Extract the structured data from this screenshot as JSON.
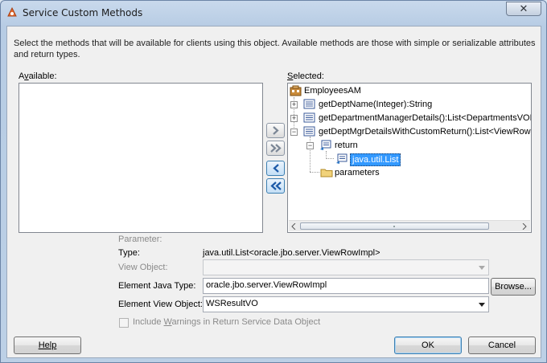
{
  "window": {
    "title": "Service Custom Methods",
    "close_symbol": "✕"
  },
  "description": "Select the methods that will be available for clients using this object.  Available methods are those with simple or serializable attributes and return types.",
  "available": {
    "label_pre": "A",
    "label_mnemonic": "v",
    "label_post": "ailable:"
  },
  "selected": {
    "label_mnemonic": "S",
    "label_post": "elected:",
    "tree": {
      "root": "EmployeesAM",
      "methods": [
        "getDeptName(Integer):String",
        "getDepartmentManagerDetails():List<DepartmentsVOR",
        "getDeptMgrDetailsWithCustomReturn():List<ViewRowI"
      ],
      "return_node": "return",
      "return_type": "java.util.List",
      "parameters_node": "parameters"
    }
  },
  "move_buttons": {
    "add_one": "add-selected-icon",
    "add_all": "add-all-icon",
    "remove_one": "remove-selected-icon",
    "remove_all": "remove-all-icon"
  },
  "details": {
    "parameter_label": "Parameter:",
    "type_label": "Type:",
    "type_value": "java.util.List<oracle.jbo.server.ViewRowImpl>",
    "view_object_label": "View Object:",
    "view_object_value": "",
    "element_java_type_label": "Element Java Type:",
    "element_java_type_value": "oracle.jbo.server.ViewRowImpl",
    "browse_label": "Browse...",
    "element_view_object_label": "Element View Object:",
    "element_view_object_value": "WSResultVO",
    "include_warnings_pre": "Include ",
    "include_warnings_mnemonic": "W",
    "include_warnings_post": "arnings in Return Service Data Object"
  },
  "buttons": {
    "help": "Help",
    "ok": "OK",
    "cancel": "Cancel"
  },
  "colors": {
    "selection": "#3399ff",
    "titlebar": "#c9d9ec"
  }
}
